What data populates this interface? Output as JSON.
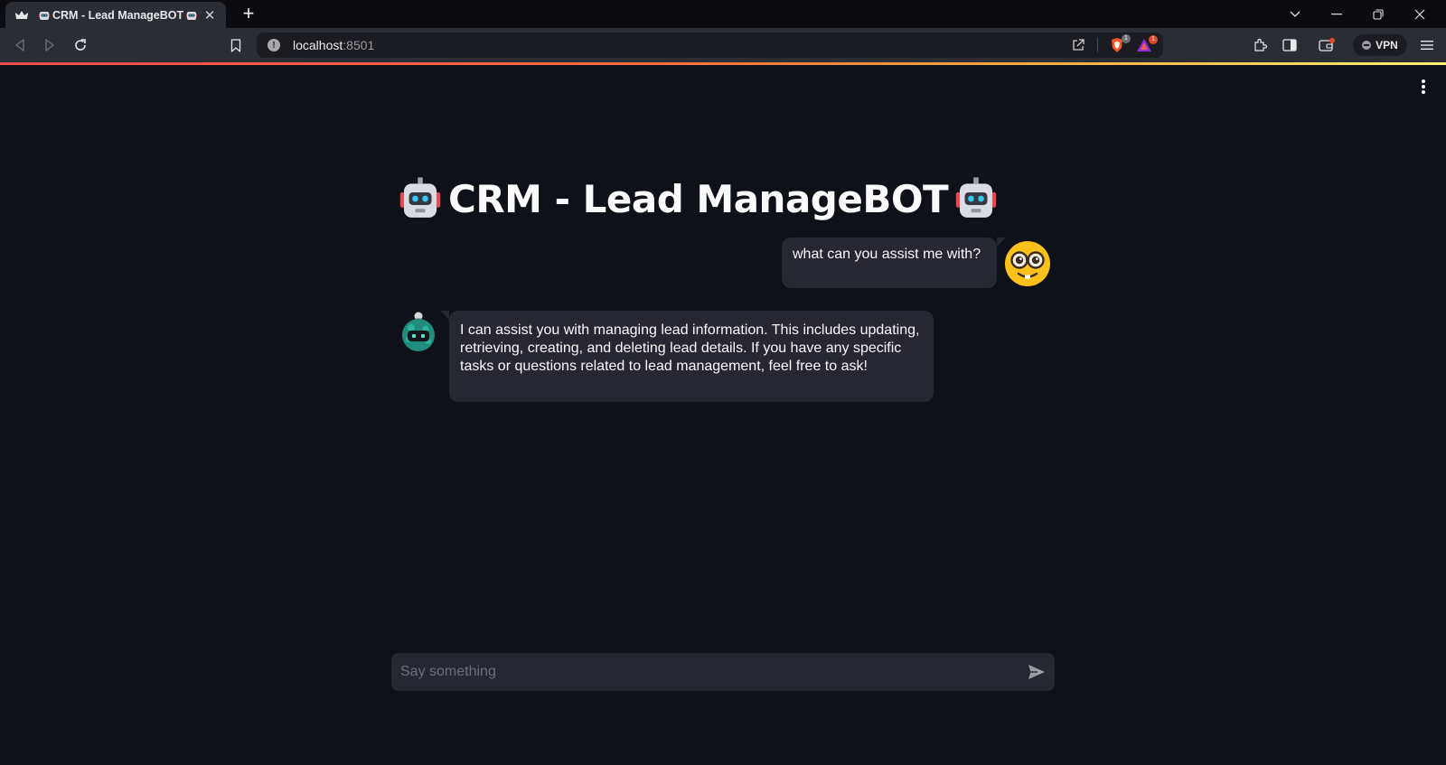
{
  "browser": {
    "tab": {
      "title": "CRM - Lead ManageBOT",
      "favicon": "crown-icon",
      "leading_emoji": "robot-icon",
      "trailing_emoji": "robot-icon"
    },
    "url": {
      "host": "localhost",
      "port": ":8501"
    },
    "vpn_label": "VPN",
    "brave_shields_badge": "1",
    "rewards_badge": "1"
  },
  "app": {
    "title": "CRM - Lead ManageBOT",
    "title_emoji": "robot-icon",
    "messages": [
      {
        "role": "user",
        "avatar": "nerd-face-icon",
        "text": "what can you assist me with?"
      },
      {
        "role": "assistant",
        "avatar": "bot-avatar-icon",
        "text": "I can assist you with managing lead information. This includes updating, retrieving, creating, and deleting lead details. If you have any specific tasks or questions related to lead management, feel free to ask!"
      }
    ],
    "chat_input": {
      "placeholder": "Say something",
      "value": ""
    }
  },
  "colors": {
    "app_background": "#0e1117",
    "bubble": "#262730",
    "text": "#fafafa",
    "accent_gradient_start": "#ff4b4b",
    "accent_gradient_end": "#fff176"
  }
}
